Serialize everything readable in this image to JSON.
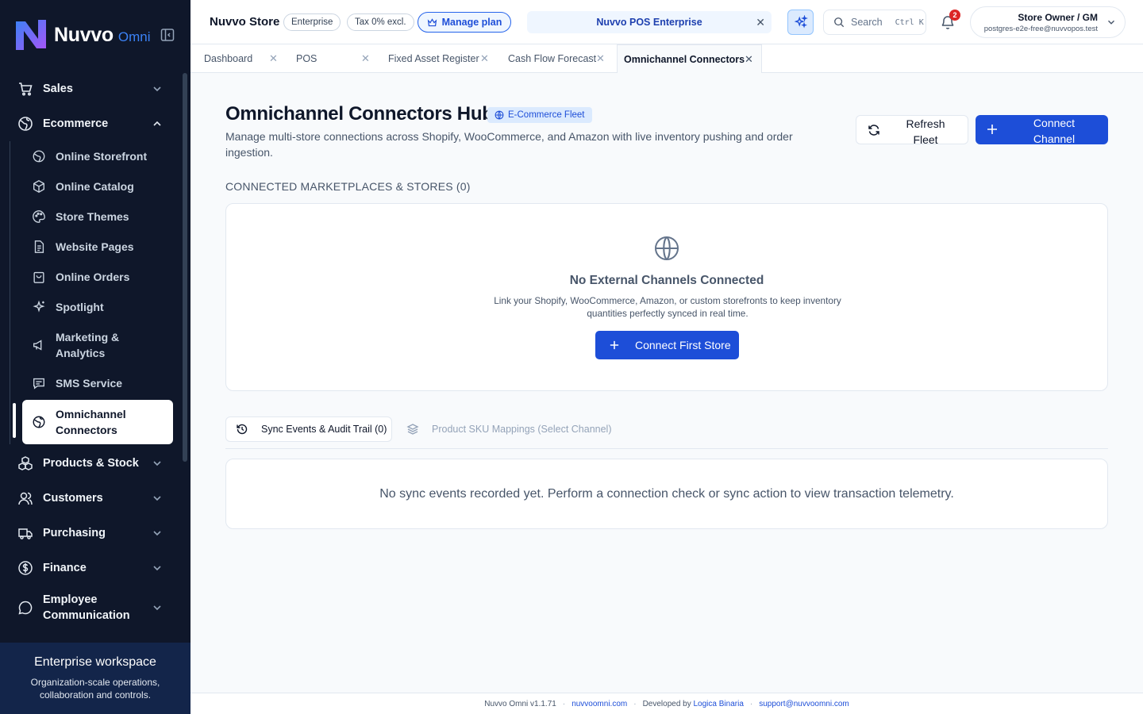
{
  "brand": {
    "name": "Nuvvo",
    "sub": "Omni"
  },
  "sidebar": {
    "items": [
      {
        "label": "Sales"
      },
      {
        "label": "Ecommerce"
      },
      {
        "label": "Products & Stock"
      },
      {
        "label": "Customers"
      },
      {
        "label": "Purchasing"
      },
      {
        "label": "Finance"
      },
      {
        "label": "Employee Communication"
      }
    ],
    "ecommerce_sub": [
      {
        "label": "Online Storefront"
      },
      {
        "label": "Online Catalog"
      },
      {
        "label": "Store Themes"
      },
      {
        "label": "Website Pages"
      },
      {
        "label": "Online Orders"
      },
      {
        "label": "Spotlight"
      },
      {
        "label": "Marketing & Analytics"
      },
      {
        "label": "SMS Service"
      },
      {
        "label": "Omnichannel Connectors"
      }
    ],
    "workspace_title": "Enterprise workspace",
    "workspace_text": "Organization-scale operations, collaboration and controls."
  },
  "topbar": {
    "store_name": "Nuvvo Store",
    "chip_enterprise": "Enterprise",
    "chip_tax": "Tax 0% excl.",
    "manage_plan": "Manage plan",
    "banner": "Nuvvo POS Enterprise",
    "search_placeholder": "Search",
    "search_shortcut": "Ctrl K",
    "notifications_count": "2",
    "user_role": "Store Owner / GM",
    "user_email": "postgres-e2e-free@nuvvopos.test"
  },
  "tabs": [
    {
      "label": "Dashboard"
    },
    {
      "label": "POS"
    },
    {
      "label": "Fixed Asset Register"
    },
    {
      "label": "Cash Flow Forecast"
    },
    {
      "label": "Omnichannel Connectors"
    }
  ],
  "main": {
    "title": "Omnichannel Connectors Hub",
    "fleet_chip": "E-Commerce Fleet",
    "description": "Manage multi-store connections across Shopify, WooCommerce, and Amazon with live inventory pushing and order ingestion.",
    "refresh_label": "Refresh Fleet",
    "connect_label": "Connect Channel",
    "section_label": "CONNECTED MARKETPLACES & STORES (0)",
    "empty_title": "No External Channels Connected",
    "empty_text": "Link your Shopify, WooCommerce, Amazon, or custom storefronts to keep inventory quantities perfectly synced in real time.",
    "connect_first_label": "Connect First Store",
    "subtab_sync": "Sync Events & Audit Trail (0)",
    "subtab_sku": "Product SKU Mappings (Select Channel)",
    "events_empty": "No sync events recorded yet. Perform a connection check or sync action to view transaction telemetry."
  },
  "footer": {
    "version": "Nuvvo Omni v1.1.71",
    "site": "nuvvoomni.com",
    "developed_by": "Developed by",
    "developer": "Logica Binaria",
    "support": "support@nuvvoomni.com"
  },
  "colors": {
    "accent": "#1d4ed8",
    "sidebar_bg": "#0f172a",
    "badge": "#dc2626"
  }
}
